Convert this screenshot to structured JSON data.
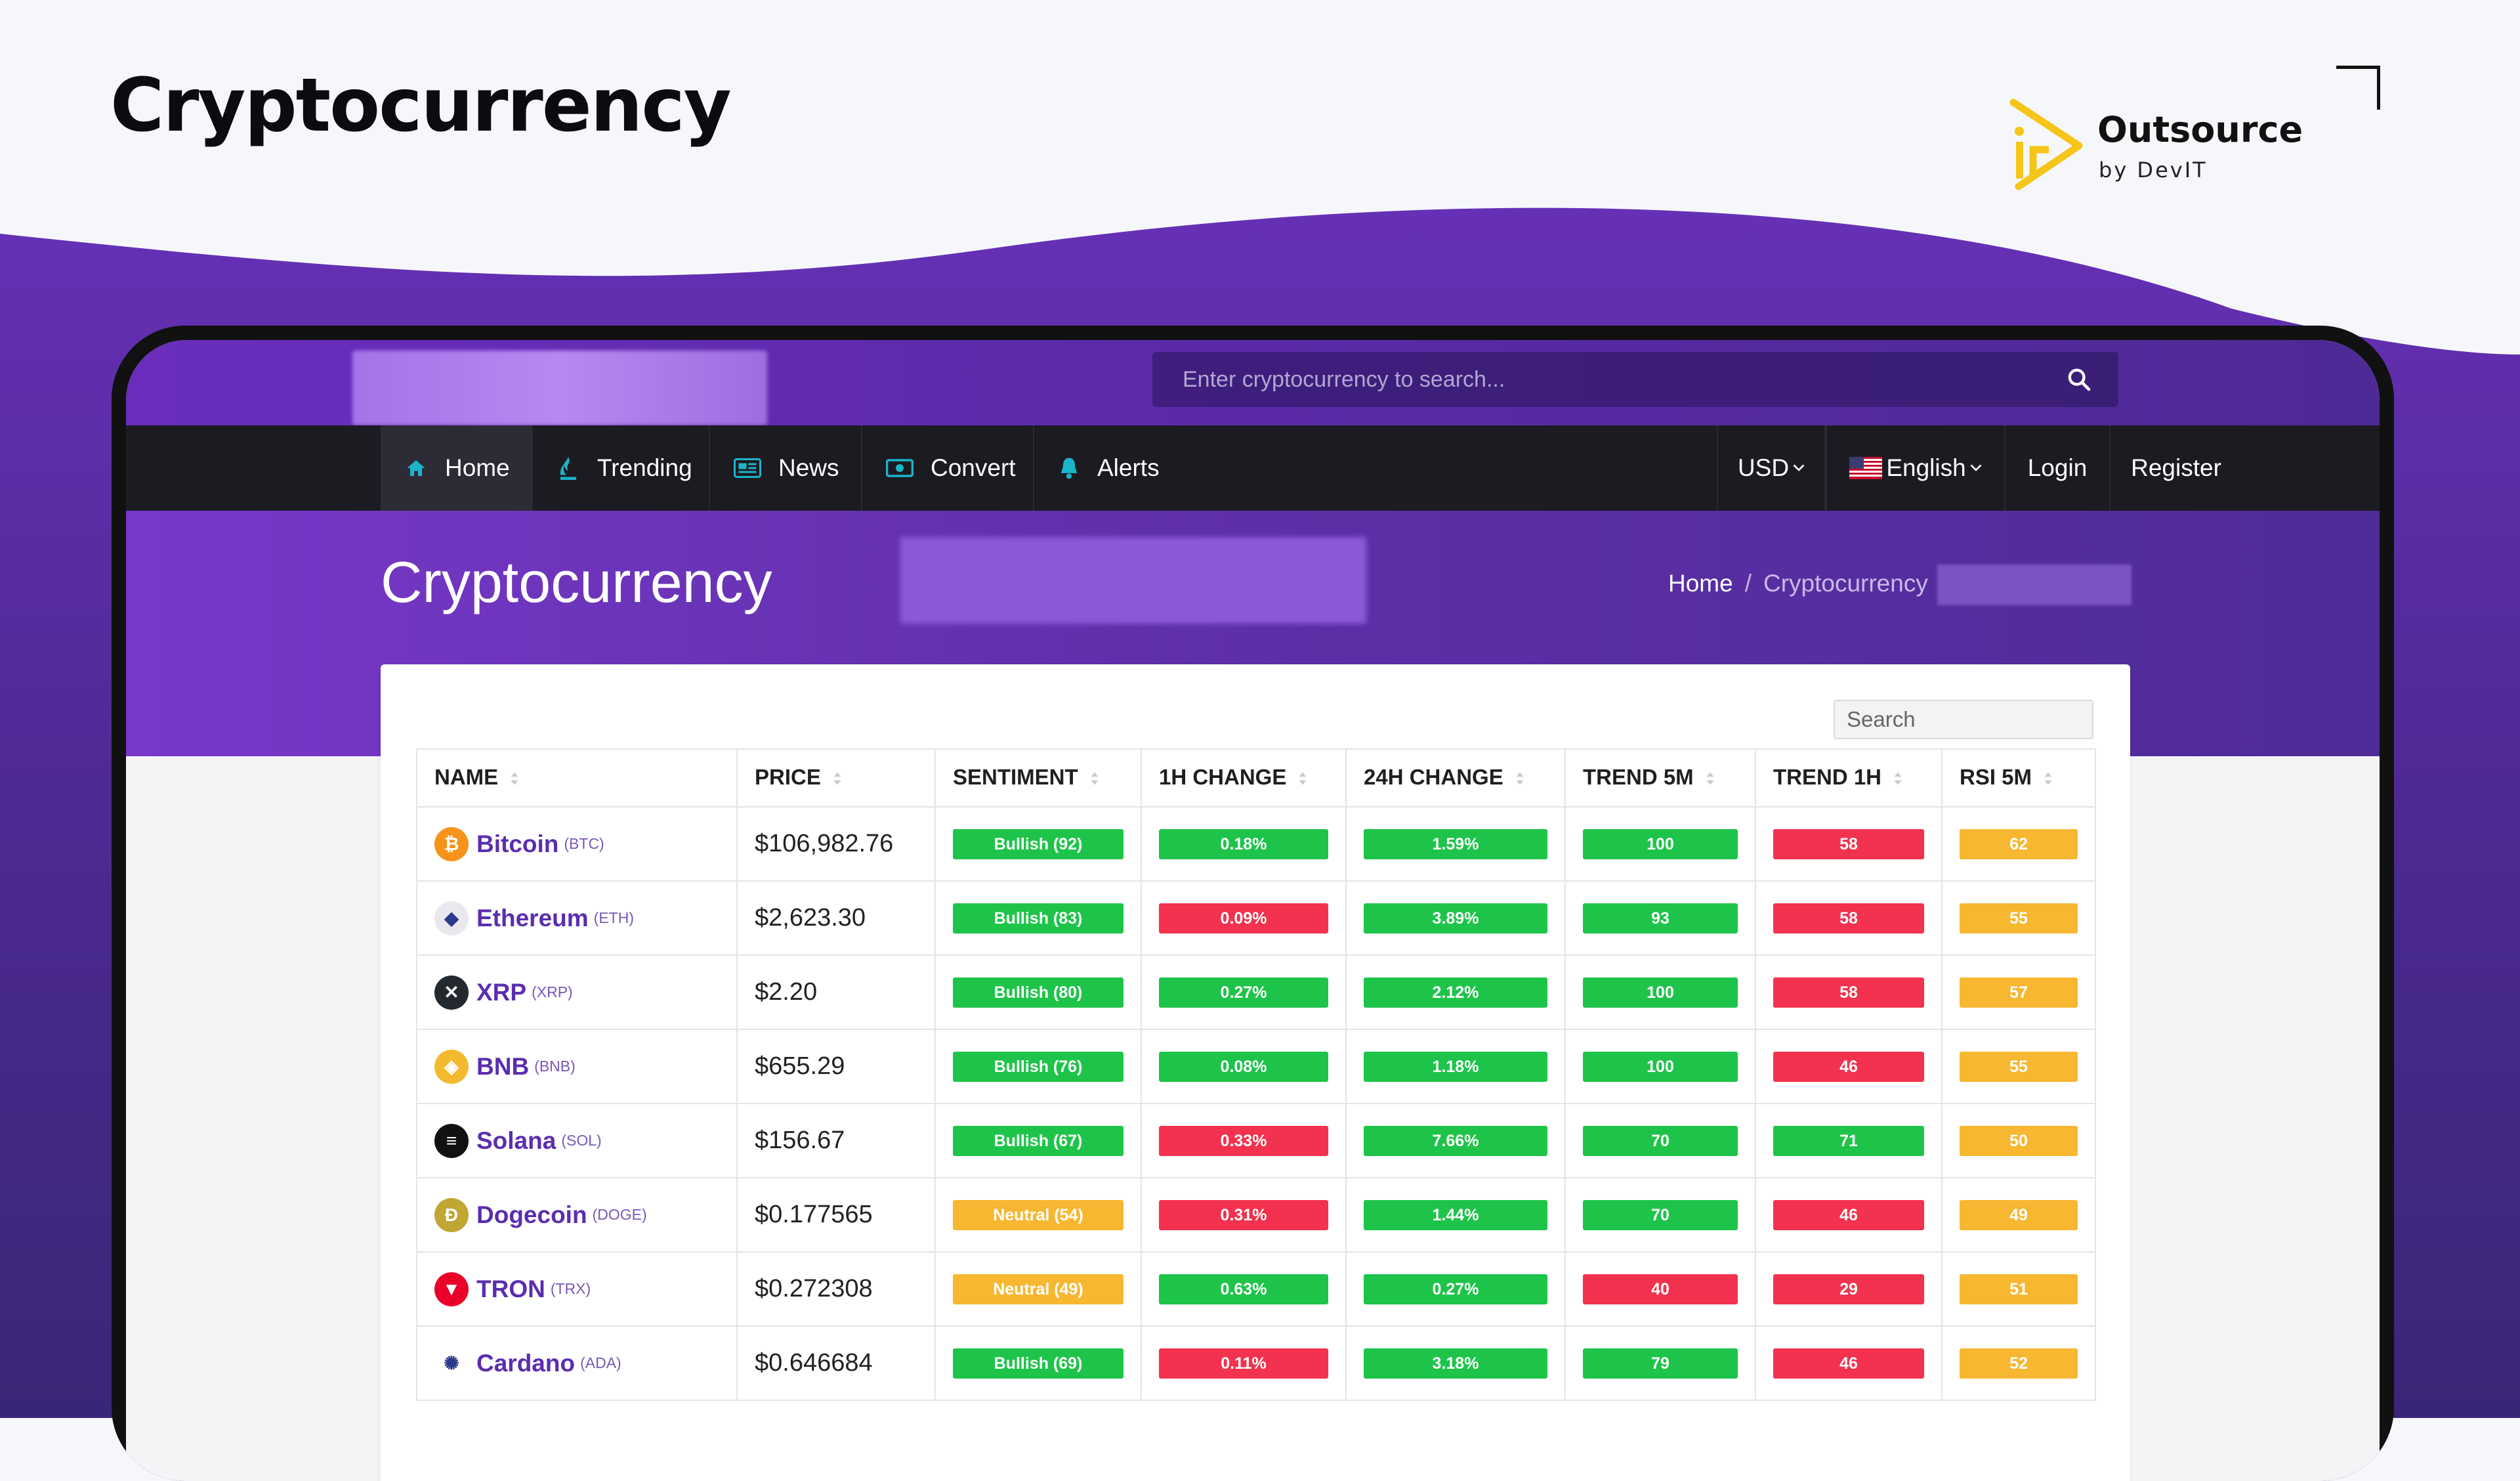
{
  "slide": {
    "title": "Cryptocurrency",
    "brand_name": "Outsource",
    "brand_sub": "by DevIT"
  },
  "colors": {
    "accent_purple": "#6a2dbd",
    "nav_dark": "#1c1b22",
    "bullish_green": "#1ec44a",
    "bearish_red": "#f2324e",
    "neutral_orange": "#f7b731",
    "brand_yellow": "#f5c518"
  },
  "topbar": {
    "search_placeholder": "Enter cryptocurrency to search..."
  },
  "nav": {
    "items": [
      {
        "label": "Home",
        "icon": "home-icon"
      },
      {
        "label": "Trending",
        "icon": "trending-icon"
      },
      {
        "label": "News",
        "icon": "news-icon"
      },
      {
        "label": "Convert",
        "icon": "convert-icon"
      },
      {
        "label": "Alerts",
        "icon": "bell-icon"
      }
    ],
    "currency": "USD",
    "language": "English",
    "login": "Login",
    "register": "Register"
  },
  "hero": {
    "title": "Cryptocurrency",
    "breadcrumb_home": "Home",
    "breadcrumb_sep": "/",
    "breadcrumb_current": "Cryptocurrency"
  },
  "table": {
    "search_placeholder": "Search",
    "columns": [
      "Name",
      "Price",
      "Sentiment",
      "1H Change",
      "24H Change",
      "Trend 5M",
      "Trend 1H",
      "RSI 5M"
    ],
    "rows": [
      {
        "name": "Bitcoin",
        "symbol": "(BTC)",
        "logo_glyph": "₿",
        "logo_color": "#f7931a",
        "price": "$106,982.76",
        "sentiment": {
          "text": "Bullish (92)",
          "status": "green"
        },
        "change_1h": {
          "text": "0.18%",
          "status": "green"
        },
        "change_24h": {
          "text": "1.59%",
          "status": "green"
        },
        "trend_5m": {
          "text": "100",
          "status": "green"
        },
        "trend_1h": {
          "text": "58",
          "status": "red"
        },
        "rsi_5m": {
          "text": "62",
          "status": "orange"
        }
      },
      {
        "name": "Ethereum",
        "symbol": "(ETH)",
        "logo_glyph": "◆",
        "logo_color": "#e8e8ee",
        "price": "$2,623.30",
        "sentiment": {
          "text": "Bullish (83)",
          "status": "green"
        },
        "change_1h": {
          "text": "0.09%",
          "status": "red"
        },
        "change_24h": {
          "text": "3.89%",
          "status": "green"
        },
        "trend_5m": {
          "text": "93",
          "status": "green"
        },
        "trend_1h": {
          "text": "58",
          "status": "red"
        },
        "rsi_5m": {
          "text": "55",
          "status": "orange"
        }
      },
      {
        "name": "XRP",
        "symbol": "(XRP)",
        "logo_glyph": "✕",
        "logo_color": "#23292f",
        "price": "$2.20",
        "sentiment": {
          "text": "Bullish (80)",
          "status": "green"
        },
        "change_1h": {
          "text": "0.27%",
          "status": "green"
        },
        "change_24h": {
          "text": "2.12%",
          "status": "green"
        },
        "trend_5m": {
          "text": "100",
          "status": "green"
        },
        "trend_1h": {
          "text": "58",
          "status": "red"
        },
        "rsi_5m": {
          "text": "57",
          "status": "orange"
        }
      },
      {
        "name": "BNB",
        "symbol": "(BNB)",
        "logo_glyph": "◈",
        "logo_color": "#f3ba2f",
        "price": "$655.29",
        "sentiment": {
          "text": "Bullish (76)",
          "status": "green"
        },
        "change_1h": {
          "text": "0.08%",
          "status": "green"
        },
        "change_24h": {
          "text": "1.18%",
          "status": "green"
        },
        "trend_5m": {
          "text": "100",
          "status": "green"
        },
        "trend_1h": {
          "text": "46",
          "status": "red"
        },
        "rsi_5m": {
          "text": "55",
          "status": "orange"
        }
      },
      {
        "name": "Solana",
        "symbol": "(SOL)",
        "logo_glyph": "≡",
        "logo_color": "#111111",
        "price": "$156.67",
        "sentiment": {
          "text": "Bullish (67)",
          "status": "green"
        },
        "change_1h": {
          "text": "0.33%",
          "status": "red"
        },
        "change_24h": {
          "text": "7.66%",
          "status": "green"
        },
        "trend_5m": {
          "text": "70",
          "status": "green"
        },
        "trend_1h": {
          "text": "71",
          "status": "green"
        },
        "rsi_5m": {
          "text": "50",
          "status": "orange"
        }
      },
      {
        "name": "Dogecoin",
        "symbol": "(DOGE)",
        "logo_glyph": "Ð",
        "logo_color": "#c2a633",
        "price": "$0.177565",
        "sentiment": {
          "text": "Neutral (54)",
          "status": "orange"
        },
        "change_1h": {
          "text": "0.31%",
          "status": "red"
        },
        "change_24h": {
          "text": "1.44%",
          "status": "green"
        },
        "trend_5m": {
          "text": "70",
          "status": "green"
        },
        "trend_1h": {
          "text": "46",
          "status": "red"
        },
        "rsi_5m": {
          "text": "49",
          "status": "orange"
        }
      },
      {
        "name": "TRON",
        "symbol": "(TRX)",
        "logo_glyph": "▼",
        "logo_color": "#eb0029",
        "price": "$0.272308",
        "sentiment": {
          "text": "Neutral (49)",
          "status": "orange"
        },
        "change_1h": {
          "text": "0.63%",
          "status": "green"
        },
        "change_24h": {
          "text": "0.27%",
          "status": "green"
        },
        "trend_5m": {
          "text": "40",
          "status": "red"
        },
        "trend_1h": {
          "text": "29",
          "status": "red"
        },
        "rsi_5m": {
          "text": "51",
          "status": "orange"
        }
      },
      {
        "name": "Cardano",
        "symbol": "(ADA)",
        "logo_glyph": "✺",
        "logo_color": "#ffffff",
        "price": "$0.646684",
        "sentiment": {
          "text": "Bullish (69)",
          "status": "green"
        },
        "change_1h": {
          "text": "0.11%",
          "status": "red"
        },
        "change_24h": {
          "text": "3.18%",
          "status": "green"
        },
        "trend_5m": {
          "text": "79",
          "status": "green"
        },
        "trend_1h": {
          "text": "46",
          "status": "red"
        },
        "rsi_5m": {
          "text": "52",
          "status": "orange"
        }
      }
    ]
  }
}
